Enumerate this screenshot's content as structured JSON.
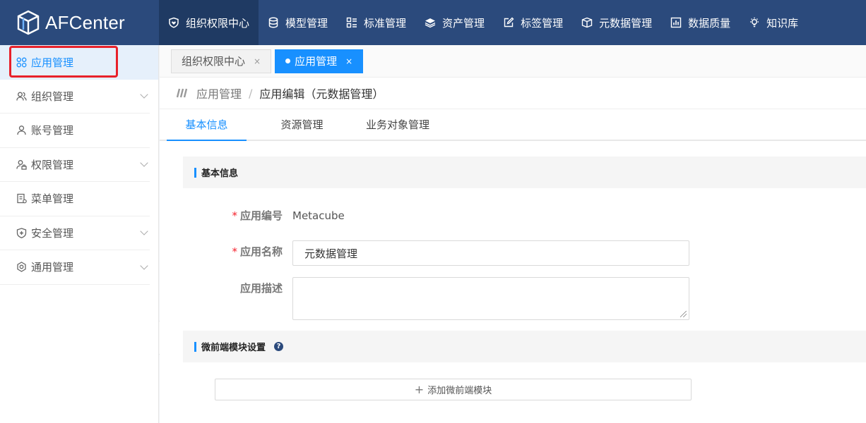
{
  "brand": {
    "name": "AFCenter"
  },
  "topnav": [
    {
      "label": "组织权限中心",
      "icon": "shield-heart-icon",
      "active": true
    },
    {
      "label": "模型管理",
      "icon": "database-icon"
    },
    {
      "label": "标准管理",
      "icon": "grid-list-icon"
    },
    {
      "label": "资产管理",
      "icon": "layers-icon"
    },
    {
      "label": "标签管理",
      "icon": "edit-icon"
    },
    {
      "label": "元数据管理",
      "icon": "box-icon"
    },
    {
      "label": "数据质量",
      "icon": "bar-chart-icon"
    },
    {
      "label": "知识库",
      "icon": "lightbulb-icon"
    }
  ],
  "sidebar": {
    "items": [
      {
        "label": "应用管理",
        "icon": "apps-icon",
        "active": true
      },
      {
        "label": "组织管理",
        "icon": "users-icon",
        "expandable": true
      },
      {
        "label": "账号管理",
        "icon": "user-icon"
      },
      {
        "label": "权限管理",
        "icon": "user-lock-icon",
        "expandable": true
      },
      {
        "label": "菜单管理",
        "icon": "menu-doc-icon"
      },
      {
        "label": "安全管理",
        "icon": "shield-plus-icon",
        "expandable": true
      },
      {
        "label": "通用管理",
        "icon": "settings-icon",
        "expandable": true
      }
    ]
  },
  "tags": [
    {
      "label": "组织权限中心",
      "close": "×"
    },
    {
      "label": "应用管理",
      "close": "×",
      "active": true
    }
  ],
  "breadcrumb": {
    "parent": "应用管理",
    "separator": "/",
    "current": "应用编辑（元数据管理）"
  },
  "tabs": [
    {
      "label": "基本信息",
      "active": true
    },
    {
      "label": "资源管理"
    },
    {
      "label": "业务对象管理"
    }
  ],
  "basic": {
    "title": "基本信息",
    "code_label": "应用编号",
    "code_value": "Metacube",
    "name_label": "应用名称",
    "name_value": "元数据管理",
    "desc_label": "应用描述",
    "required_mark": "*"
  },
  "micro": {
    "title": "微前端模块设置",
    "help": "?",
    "add_label": "添加微前端模块",
    "add_plus": "+"
  },
  "colors": {
    "topbar": "#2b4a7c",
    "accent": "#1890ff",
    "highlight": "#e8212a"
  }
}
